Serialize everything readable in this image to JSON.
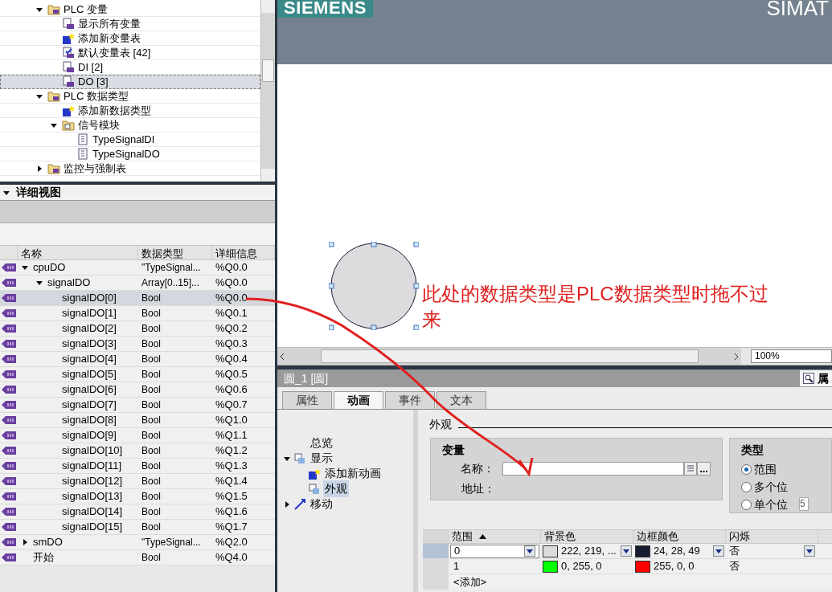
{
  "project_tree": {
    "items": [
      {
        "label": "PLC 变量",
        "kind": "folder",
        "expanded": true,
        "selected": false,
        "children": [
          {
            "label": "显示所有变量",
            "kind": "all",
            "selected": false
          },
          {
            "label": "添加新变量表",
            "kind": "add",
            "selected": false
          },
          {
            "label": "默认变量表 [42]",
            "kind": "table-default",
            "selected": false
          },
          {
            "label": "DI [2]",
            "kind": "table",
            "selected": false
          },
          {
            "label": "DO [3]",
            "kind": "table",
            "selected": true
          }
        ]
      },
      {
        "label": "PLC 数据类型",
        "kind": "folder",
        "expanded": true,
        "selected": false,
        "children": [
          {
            "label": "添加新数据类型",
            "kind": "add",
            "selected": false
          },
          {
            "label": "信号模块",
            "kind": "group",
            "expanded": true,
            "selected": false,
            "children": [
              {
                "label": "TypeSignalDI",
                "kind": "type",
                "selected": false
              },
              {
                "label": "TypeSignalDO",
                "kind": "type",
                "selected": false
              }
            ]
          }
        ]
      },
      {
        "label": "监控与强制表",
        "kind": "folder",
        "expanded": false,
        "selected": false
      }
    ]
  },
  "detail_view": {
    "title": "详细视图",
    "expanded": true,
    "columns": [
      "名称",
      "数据类型",
      "详细信息"
    ],
    "rows": [
      {
        "name": "cpuDO",
        "type": "\"TypeSignal...",
        "detail": "%Q0.0",
        "expanded": true,
        "selected": false,
        "children": [
          {
            "name": "signalDO",
            "type": "Array[0..15]...",
            "detail": "%Q0.0",
            "expanded": true,
            "selected": false,
            "children": [
              {
                "name": "signalDO[0]",
                "type": "Bool",
                "detail": "%Q0.0",
                "selected": true
              },
              {
                "name": "signalDO[1]",
                "type": "Bool",
                "detail": "%Q0.1",
                "selected": false
              },
              {
                "name": "signalDO[2]",
                "type": "Bool",
                "detail": "%Q0.2",
                "selected": false
              },
              {
                "name": "signalDO[3]",
                "type": "Bool",
                "detail": "%Q0.3",
                "selected": false
              },
              {
                "name": "signalDO[4]",
                "type": "Bool",
                "detail": "%Q0.4",
                "selected": false
              },
              {
                "name": "signalDO[5]",
                "type": "Bool",
                "detail": "%Q0.5",
                "selected": false
              },
              {
                "name": "signalDO[6]",
                "type": "Bool",
                "detail": "%Q0.6",
                "selected": false
              },
              {
                "name": "signalDO[7]",
                "type": "Bool",
                "detail": "%Q0.7",
                "selected": false
              },
              {
                "name": "signalDO[8]",
                "type": "Bool",
                "detail": "%Q1.0",
                "selected": false
              },
              {
                "name": "signalDO[9]",
                "type": "Bool",
                "detail": "%Q1.1",
                "selected": false
              },
              {
                "name": "signalDO[10]",
                "type": "Bool",
                "detail": "%Q1.2",
                "selected": false
              },
              {
                "name": "signalDO[11]",
                "type": "Bool",
                "detail": "%Q1.3",
                "selected": false
              },
              {
                "name": "signalDO[12]",
                "type": "Bool",
                "detail": "%Q1.4",
                "selected": false
              },
              {
                "name": "signalDO[13]",
                "type": "Bool",
                "detail": "%Q1.5",
                "selected": false
              },
              {
                "name": "signalDO[14]",
                "type": "Bool",
                "detail": "%Q1.6",
                "selected": false
              },
              {
                "name": "signalDO[15]",
                "type": "Bool",
                "detail": "%Q1.7",
                "selected": false
              }
            ]
          }
        ]
      },
      {
        "name": "smDO",
        "type": "\"TypeSignal...",
        "detail": "%Q2.0",
        "expanded": false,
        "selected": false
      },
      {
        "name": "开始",
        "type": "Bool",
        "detail": "%Q4.0",
        "selected": false
      }
    ]
  },
  "editor": {
    "logo": "SIEMENS",
    "header_text": "SIMAT",
    "annotation": "此处的数据类型是PLC数据类型时拖不过来",
    "zoom": "100%"
  },
  "properties": {
    "title": "圆_1 [圆]",
    "side_tab": "属",
    "tabs": [
      {
        "label": "属性",
        "selected": false
      },
      {
        "label": "动画",
        "selected": true
      },
      {
        "label": "事件",
        "selected": false
      },
      {
        "label": "文本",
        "selected": false
      }
    ],
    "nav": [
      {
        "label": "总览",
        "selected": false
      },
      {
        "label": "显示",
        "kind": "group",
        "expanded": true,
        "selected": false,
        "children": [
          {
            "label": "添加新动画",
            "kind": "add",
            "selected": false
          },
          {
            "label": "外观",
            "kind": "item",
            "selected": true
          }
        ]
      },
      {
        "label": "移动",
        "kind": "move",
        "expanded": false,
        "selected": false
      }
    ],
    "section": "外观",
    "variable": {
      "title": "变量",
      "name_label": "名称：",
      "address_label": "地址："
    },
    "type_group": {
      "title": "类型",
      "options": [
        {
          "label": "范围",
          "selected": true
        },
        {
          "label": "多个位",
          "selected": false
        },
        {
          "label": "单个位",
          "selected": false
        }
      ],
      "bit_field": "5"
    },
    "table": {
      "columns": [
        {
          "label": "范围",
          "sorted": true
        },
        {
          "label": "背景色",
          "sorted": false
        },
        {
          "label": "边框颜色",
          "sorted": false
        },
        {
          "label": "闪烁",
          "sorted": false
        }
      ],
      "rows": [
        {
          "range": "0",
          "background": {
            "label": "222, 219, ...",
            "color": "#dedbde"
          },
          "border": {
            "label": "24, 28, 49",
            "color": "#181c31"
          },
          "flash": "否",
          "editing": true
        },
        {
          "range": "1",
          "background": {
            "label": "0, 255, 0",
            "color": "#00ff00"
          },
          "border": {
            "label": "255, 0, 0",
            "color": "#ff0000"
          },
          "flash": "否",
          "editing": false
        }
      ],
      "add_row": "<添加>"
    }
  }
}
